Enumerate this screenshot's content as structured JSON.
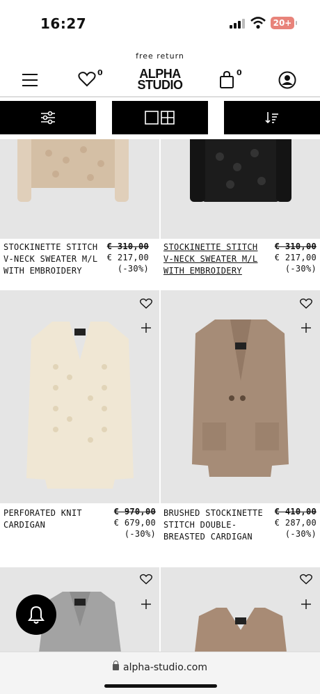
{
  "status_bar": {
    "time": "16:27",
    "battery": "20+"
  },
  "header": {
    "banner": "free return",
    "logo_line1": "ALPHA",
    "logo_line2": "STUDIO",
    "wishlist_count": "0",
    "cart_count": "0"
  },
  "toolbar": {
    "items": [
      "filter-icon",
      "grid-view-icon",
      "sort-icon"
    ]
  },
  "products": [
    {
      "name": "STOCKINETTE STITCH V-NECK SWEATER M/L WITH EMBROIDERY",
      "old_price": "€ 310,00",
      "price": "€ 217,00",
      "discount": "(-30%)",
      "image_color": "#d6c1a8"
    },
    {
      "name": "STOCKINETTE STITCH V-NECK SWEATER M/L WITH EMBROIDERY",
      "old_price": "€ 310,00",
      "price": "€ 217,00",
      "discount": "(-30%)",
      "image_color": "#1a1a1a"
    },
    {
      "name": "PERFORATED KNIT CARDIGAN",
      "old_price": "€ 970,00",
      "price": "€ 679,00",
      "discount": "(-30%)",
      "image_color": "#efe6d2"
    },
    {
      "name": "BRUSHED STOCKINETTE STITCH DOUBLE-BREASTED CARDIGAN",
      "old_price": "€ 410,00",
      "price": "€ 287,00",
      "discount": "(-30%)",
      "image_color": "#a48a76"
    },
    {
      "name": "",
      "image_color": "#9b9b9b"
    },
    {
      "name": "",
      "image_color": "#a88b75"
    }
  ],
  "browser": {
    "url": "alpha-studio.com"
  }
}
